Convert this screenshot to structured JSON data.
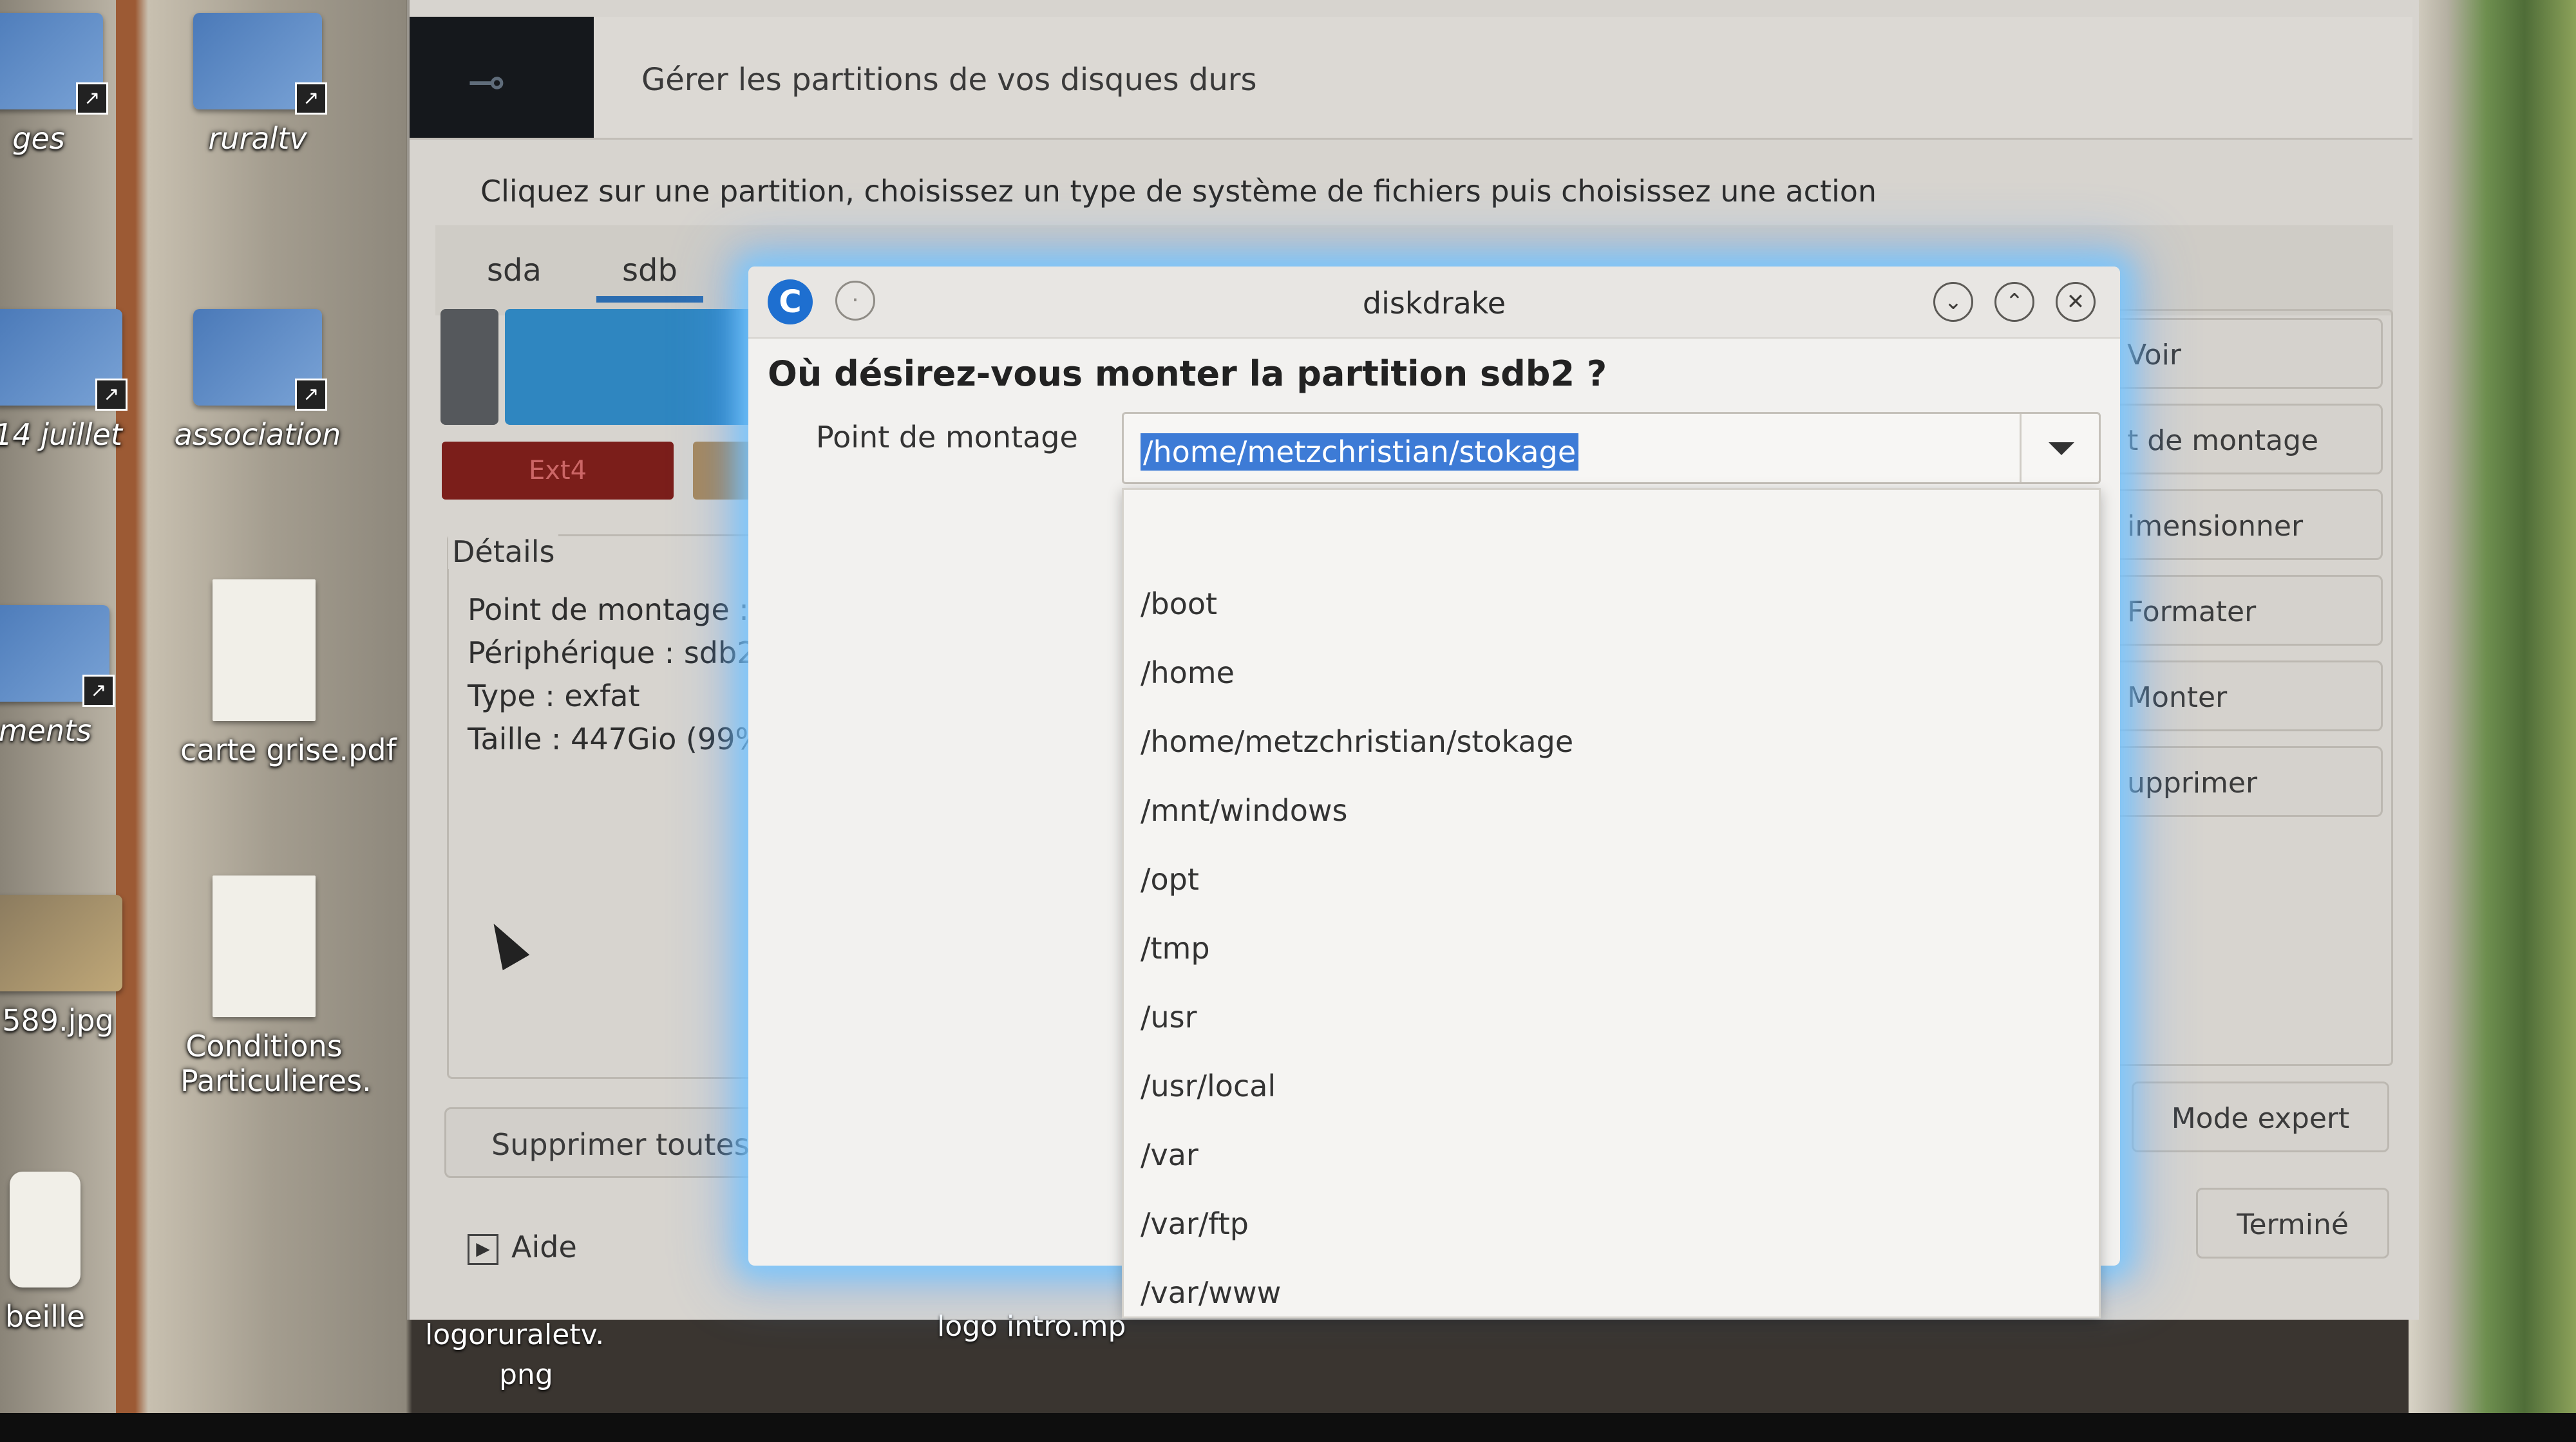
{
  "desktop": {
    "icons": [
      {
        "label": "ges"
      },
      {
        "label": "ruraltv"
      },
      {
        "label": "14 juillet"
      },
      {
        "label": "association"
      },
      {
        "label": "ments"
      },
      {
        "label": "carte grise.pdf"
      },
      {
        "label": "589.jpg"
      },
      {
        "label": "Conditions Particulieres."
      },
      {
        "label": "beille"
      }
    ],
    "bottom_labels": [
      "logoruraletv.",
      "png",
      "logo intro.mp"
    ]
  },
  "main_window": {
    "header_title": "Gérer les partitions de vos disques durs",
    "instructions": "Cliquez sur une partition, choisissez un type de système de fichiers puis choisissez une action",
    "disk_tabs": [
      {
        "label": "sda"
      },
      {
        "label": "sdb"
      }
    ],
    "active_tab": "sdb",
    "legend_ext4": "Ext4",
    "details": {
      "title": "Détails",
      "lines": [
        "Point de montage : /",
        "Périphérique : sdb2",
        "Type : exfat",
        "Taille : 447Gio (99%"
      ]
    },
    "delete_all_label": "Supprimer toutes l",
    "help_label": "Aide",
    "actions": [
      "Voir",
      "t de montage",
      "imensionner",
      "Formater",
      "Monter",
      "upprimer"
    ],
    "expert_mode_label": "Mode expert",
    "done_label": "Terminé",
    "colors": {
      "ext4": "#7b1e1a",
      "exfat": "#2f86c0",
      "tab_accent": "#2b6cb0"
    }
  },
  "dialog": {
    "title": "diskdrake",
    "question": "Où désirez-vous monter la partition sdb2 ?",
    "mount_label": "Point de montage",
    "mount_value": "/home/metzchristian/stokage",
    "options": [
      "",
      "/boot",
      "/home",
      "/home/metzchristian/stokage",
      "/mnt/windows",
      "/opt",
      "/tmp",
      "/usr",
      "/usr/local",
      "/var",
      "/var/ftp",
      "/var/www"
    ],
    "accent_color": "#3d7bd6"
  }
}
